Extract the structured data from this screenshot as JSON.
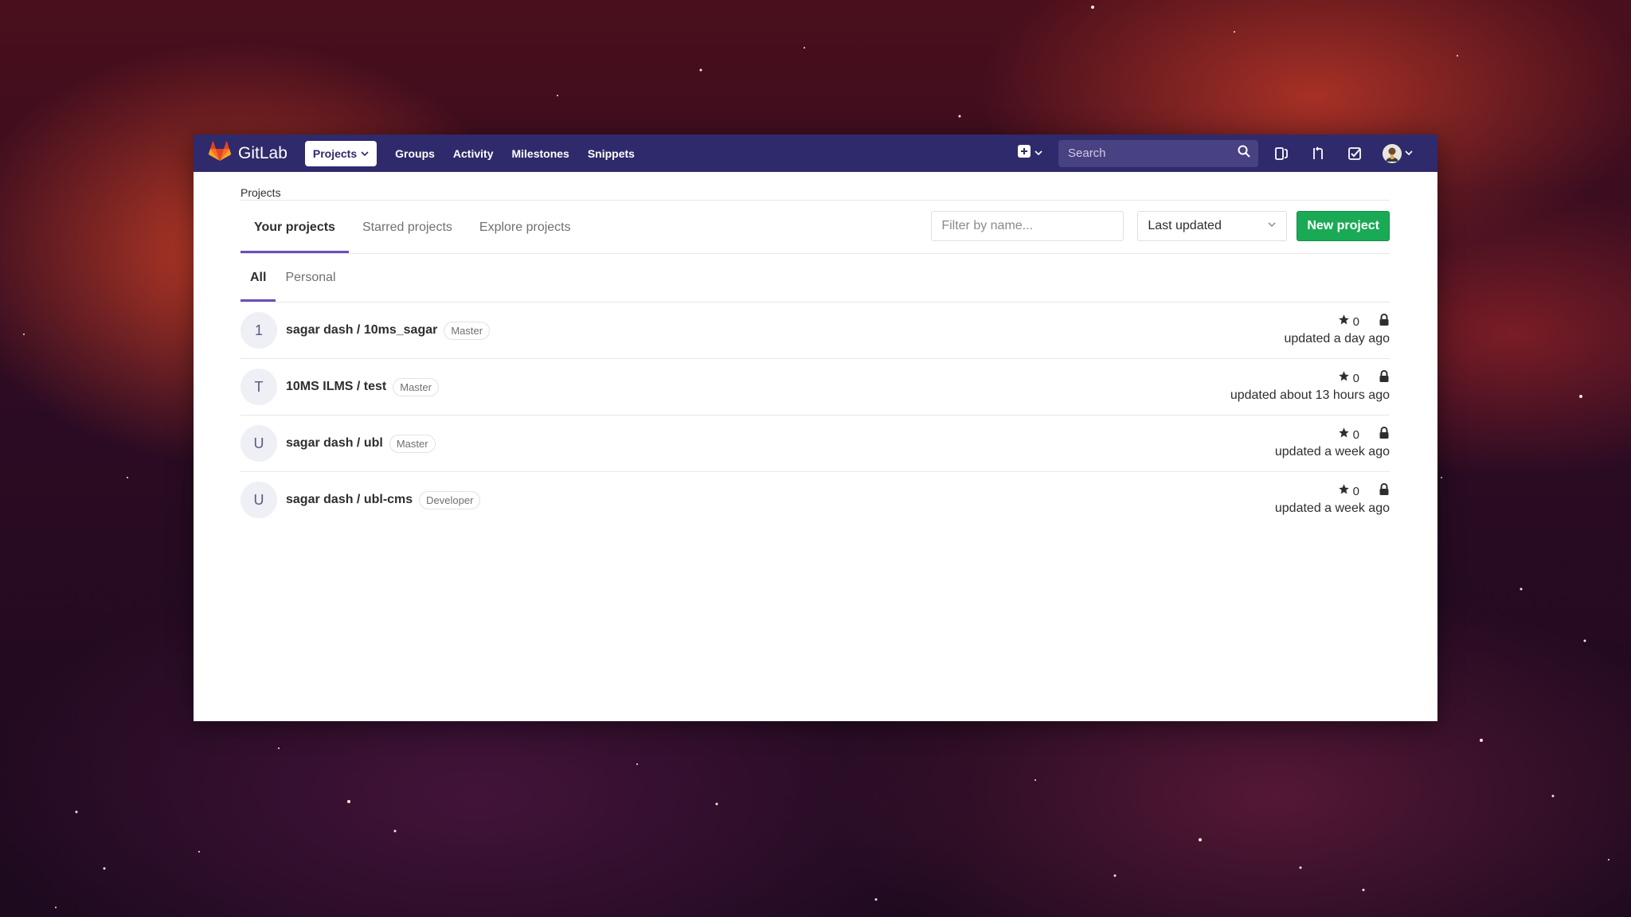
{
  "app": {
    "name": "GitLab"
  },
  "nav": {
    "projects_label": "Projects",
    "groups_label": "Groups",
    "activity_label": "Activity",
    "milestones_label": "Milestones",
    "snippets_label": "Snippets",
    "search_placeholder": "Search"
  },
  "breadcrumb": "Projects",
  "tabs": {
    "your_projects": "Your projects",
    "starred_projects": "Starred projects",
    "explore_projects": "Explore projects"
  },
  "filter_placeholder": "Filter by name...",
  "sort": {
    "selected": "Last updated"
  },
  "new_project_label": "New project",
  "subtabs": {
    "all": "All",
    "personal": "Personal"
  },
  "projects": [
    {
      "initial": "1",
      "name": "sagar dash / 10ms_sagar",
      "role": "Master",
      "stars": "0",
      "updated": "updated a day ago"
    },
    {
      "initial": "T",
      "name": "10MS ILMS / test",
      "role": "Master",
      "stars": "0",
      "updated": "updated about 13 hours ago"
    },
    {
      "initial": "U",
      "name": "sagar dash / ubl",
      "role": "Master",
      "stars": "0",
      "updated": "updated a week ago"
    },
    {
      "initial": "U",
      "name": "sagar dash / ubl-cms",
      "role": "Developer",
      "stars": "0",
      "updated": "updated a week ago"
    }
  ],
  "icons": {
    "logo": "gitlab-tanuki-icon",
    "plus": "plus-square-icon",
    "search": "search-icon",
    "issues": "issues-icon",
    "merge_requests": "merge-request-icon",
    "todos": "todo-check-icon",
    "star": "star-icon",
    "lock": "lock-icon"
  },
  "colors": {
    "navbar": "#2f2a6b",
    "accent": "#6b4fbb",
    "new_project": "#1aaa55"
  }
}
